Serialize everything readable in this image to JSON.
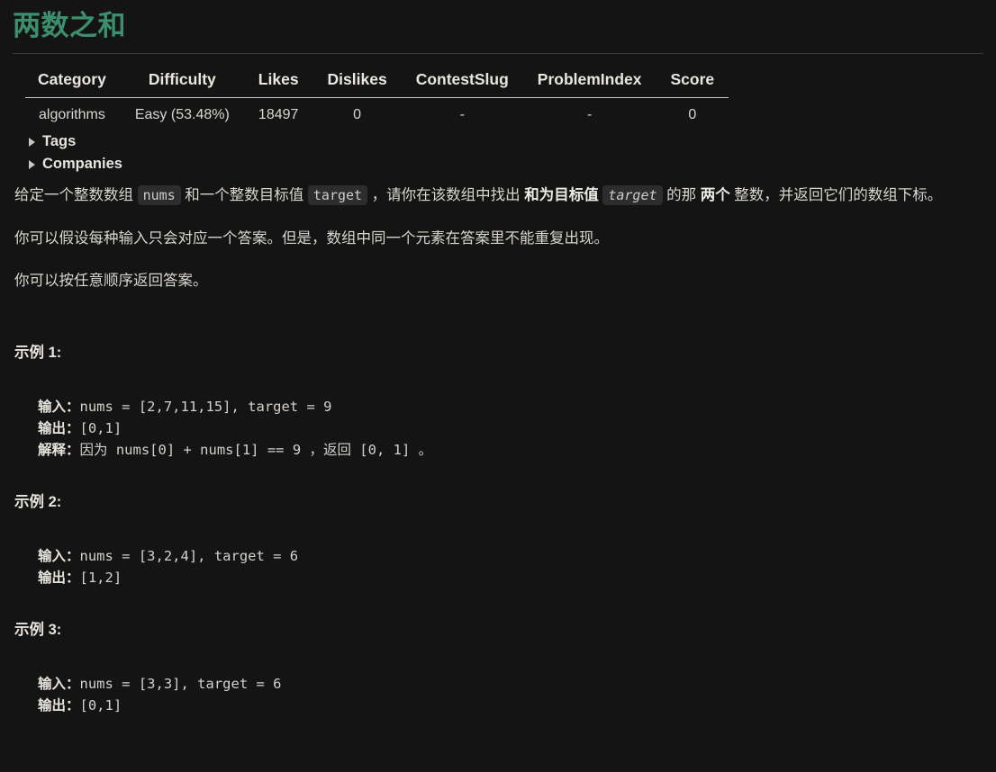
{
  "problem": {
    "title": "两数之和"
  },
  "meta_table": {
    "headers": [
      "Category",
      "Difficulty",
      "Likes",
      "Dislikes",
      "ContestSlug",
      "ProblemIndex",
      "Score"
    ],
    "rows": [
      [
        "algorithms",
        "Easy (53.48%)",
        "18497",
        "0",
        "-",
        "-",
        "0"
      ]
    ]
  },
  "disclosures": [
    {
      "label": "Tags",
      "marker": "triangle-right-icon"
    },
    {
      "label": "Companies",
      "marker": "triangle-right-icon"
    }
  ],
  "description": {
    "p1": {
      "t1": "给定一个整数数组 ",
      "c1": "nums",
      "t2": " 和一个整数目标值 ",
      "c2": "target",
      "t3": " ，请你在该数组中找出 ",
      "b1": "和为目标值",
      "t4": " ",
      "c3": "target",
      "t5": " 的那 ",
      "b2": "两个",
      "t6": " 整数，并返回它们的数组下标。"
    },
    "p2": "你可以假设每种输入只会对应一个答案。但是，数组中同一个元素在答案里不能重复出现。",
    "p3": "你可以按任意顺序返回答案。"
  },
  "examples": [
    {
      "heading": "示例 1:",
      "lines": [
        {
          "label": "输入：",
          "value": "nums = [2,7,11,15], target = 9"
        },
        {
          "label": "输出：",
          "value": "[0,1]"
        },
        {
          "label": "解释：",
          "value": "因为 nums[0] + nums[1] == 9 ，返回 [0, 1] 。"
        }
      ]
    },
    {
      "heading": "示例 2:",
      "lines": [
        {
          "label": "输入：",
          "value": "nums = [3,2,4], target = 6"
        },
        {
          "label": "输出：",
          "value": "[1,2]"
        }
      ]
    },
    {
      "heading": "示例 3:",
      "lines": [
        {
          "label": "输入：",
          "value": "nums = [3,3], target = 6"
        },
        {
          "label": "输出：",
          "value": "[0,1]"
        }
      ]
    }
  ],
  "colors": {
    "background": "#141414",
    "title_accent": "#3b8f6e",
    "body_text": "#d8d5cf",
    "code_chip_bg": "#2b2d2f",
    "rule": "#c9c6c0"
  }
}
